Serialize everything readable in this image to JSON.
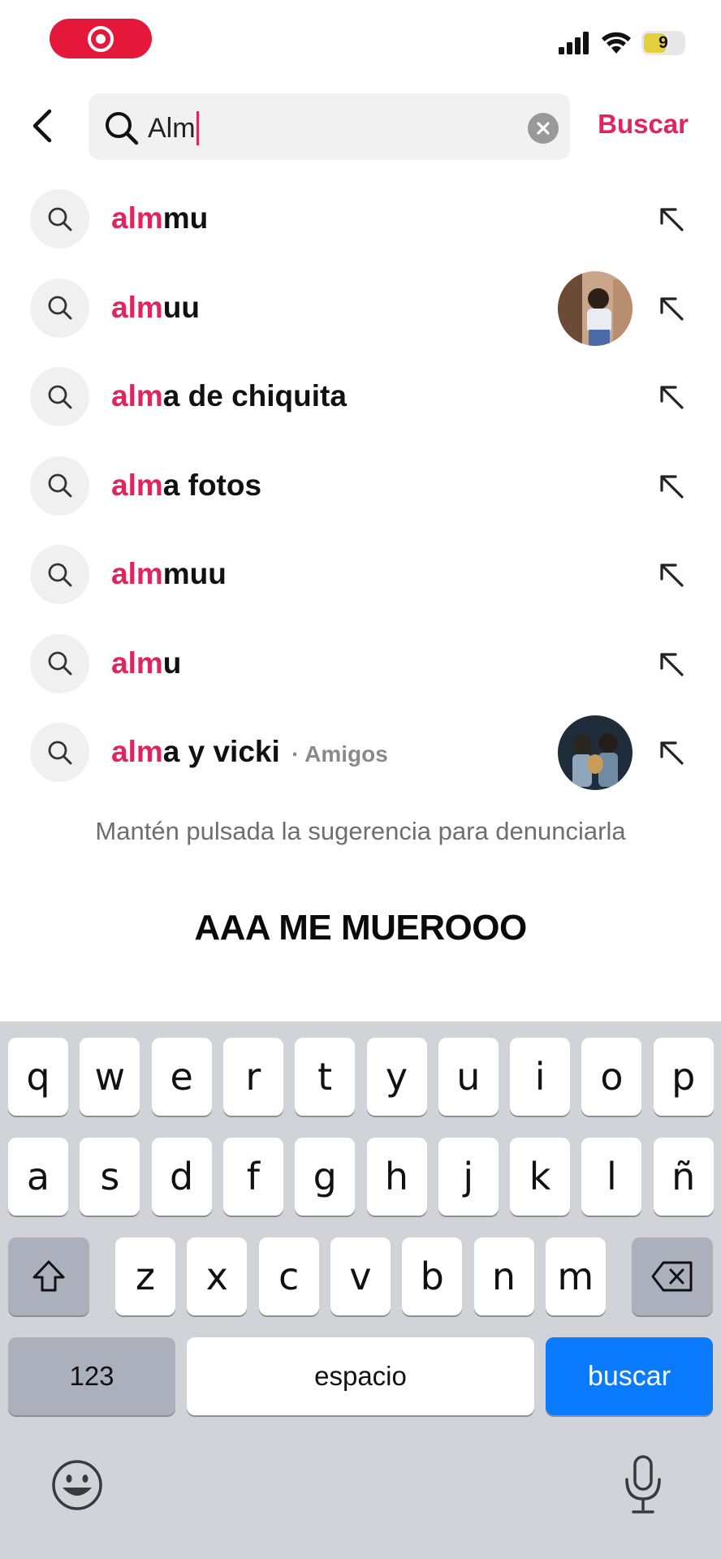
{
  "status": {
    "battery_level": "9"
  },
  "search": {
    "query": "Alm",
    "submit_label": "Buscar"
  },
  "suggestions": [
    {
      "highlight": "alm",
      "rest": "mu",
      "tag": "",
      "thumb": false
    },
    {
      "highlight": "alm",
      "rest": "uu",
      "tag": "",
      "thumb": true
    },
    {
      "highlight": "alm",
      "rest": "a de chiquita",
      "tag": "",
      "thumb": false
    },
    {
      "highlight": "alm",
      "rest": "a fotos",
      "tag": "",
      "thumb": false
    },
    {
      "highlight": "alm",
      "rest": "muu",
      "tag": "",
      "thumb": false
    },
    {
      "highlight": "alm",
      "rest": "u",
      "tag": "",
      "thumb": false
    },
    {
      "highlight": "alm",
      "rest": "a y vicki",
      "tag": "· Amigos",
      "thumb": true
    }
  ],
  "report_hint": "Mantén pulsada la sugerencia para denunciarla",
  "caption": "AAA ME MUEROOO",
  "keyboard": {
    "row1": [
      "q",
      "w",
      "e",
      "r",
      "t",
      "y",
      "u",
      "i",
      "o",
      "p"
    ],
    "row2": [
      "a",
      "s",
      "d",
      "f",
      "g",
      "h",
      "j",
      "k",
      "l",
      "ñ"
    ],
    "row3": [
      "z",
      "x",
      "c",
      "v",
      "b",
      "n",
      "m"
    ],
    "numbers_key": "123",
    "space_key": "espacio",
    "return_key": "buscar"
  },
  "colors": {
    "accent": "#e0245e",
    "record_pill": "#e5173a",
    "keyboard_bg": "#d1d3d9",
    "return_key": "#0a7aff"
  }
}
